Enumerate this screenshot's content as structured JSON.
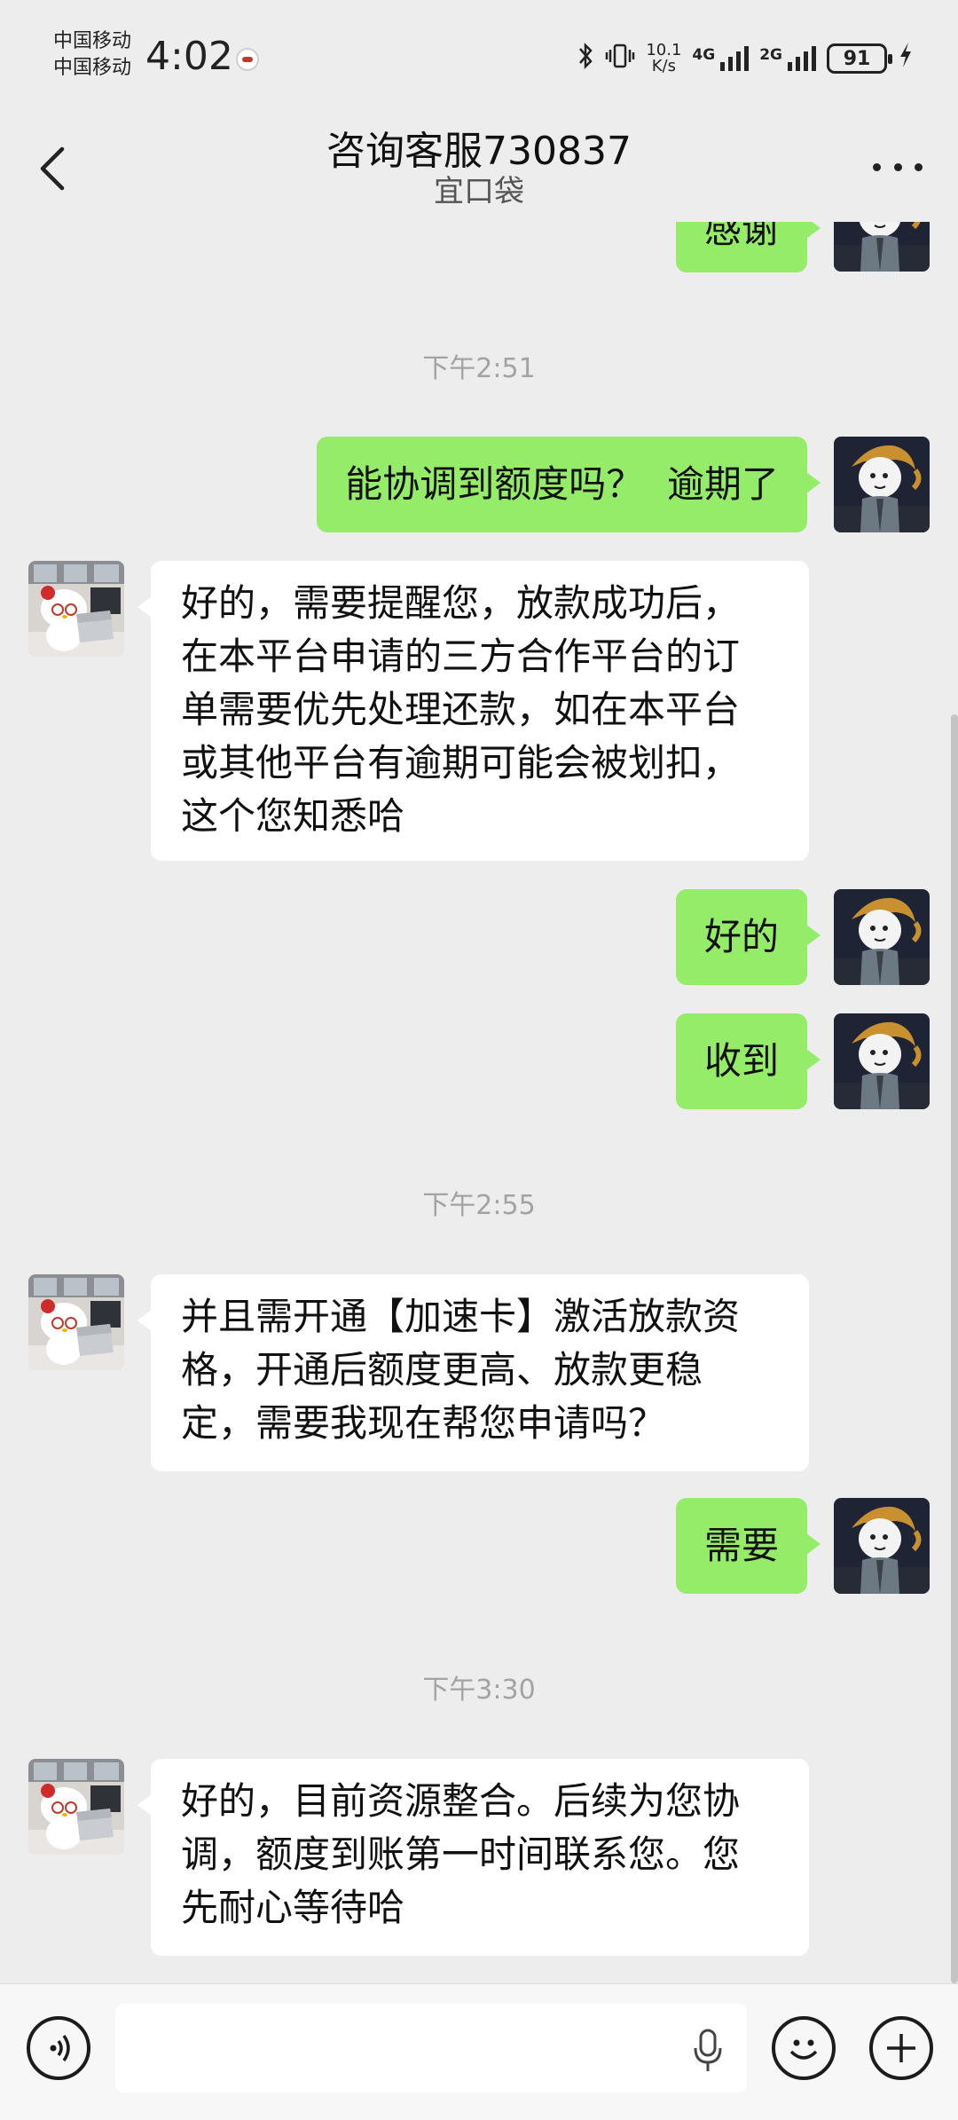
{
  "status_bar": {
    "carrier_1": "中国移动",
    "carrier_2": "中国移动",
    "time": "4:02",
    "net_speed_value": "10.1",
    "net_speed_unit": "K/s",
    "signal_1": "4G",
    "signal_2": "2G",
    "battery": "91"
  },
  "header": {
    "title": "咨询客服730837",
    "subtitle": "宜口袋"
  },
  "messages": {
    "m0": {
      "sender": "me",
      "text": "感谢"
    },
    "t1": "下午2:51",
    "m1": {
      "sender": "me",
      "text": "能协调到额度吗？  逾期了"
    },
    "m2": {
      "sender": "them",
      "line1": "好的，需要提醒您，放款成功后，",
      "line2": "在本平台申请的三方合作平台的订",
      "line3": "单需要优先处理还款，如在本平台",
      "line4": "或其他平台有逾期可能会被划扣，",
      "line5": "这个您知悉哈"
    },
    "m3": {
      "sender": "me",
      "text": "好的"
    },
    "m4": {
      "sender": "me",
      "text": "收到"
    },
    "t2": "下午2:55",
    "m5": {
      "sender": "them",
      "line1": "并且需开通【加速卡】激活放款资",
      "line2": "格，开通后额度更高、放款更稳",
      "line3": "定，需要我现在帮您申请吗？"
    },
    "m6": {
      "sender": "me",
      "text": "需要"
    },
    "t3": "下午3:30",
    "m7": {
      "sender": "them",
      "line1": "好的，目前资源整合。后续为您协",
      "line2": "调，额度到账第一时间联系您。您",
      "line3": "先耐心等待哈"
    }
  },
  "input_bar": {
    "voice_icon": "voice-mode-icon",
    "mic_icon": "microphone-icon",
    "emoji_icon": "emoji-icon",
    "plus_icon": "plus-icon",
    "text_value": ""
  },
  "colors": {
    "bubble_me": "#95ec69",
    "bubble_them": "#ffffff",
    "background": "#ededed"
  }
}
